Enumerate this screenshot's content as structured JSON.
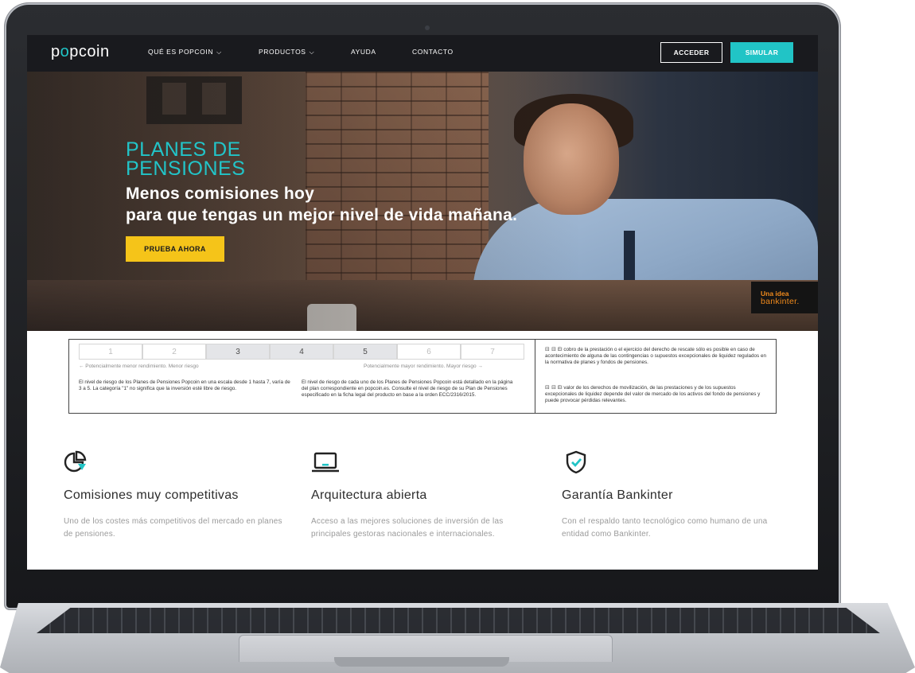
{
  "nav": {
    "logo_prefix": "p",
    "logo_o": "o",
    "logo_suffix": "pcoin",
    "items": [
      {
        "label": "QUÉ ES POPCOIN",
        "dropdown": true
      },
      {
        "label": "PRODUCTOS",
        "dropdown": true
      },
      {
        "label": "AYUDA",
        "dropdown": false
      },
      {
        "label": "CONTACTO",
        "dropdown": false
      }
    ],
    "chevron": "⌵",
    "acceder_label": "ACCEDER",
    "simular_label": "SIMULAR"
  },
  "hero": {
    "title_line1": "PLANES DE",
    "title_line2": "PENSIONES",
    "subtitle_line1": "Menos comisiones hoy",
    "subtitle_line2": "para que tengas un mejor nivel de vida mañana.",
    "cta_label": "PRUEBA AHORA",
    "badge_line1": "Una idea",
    "badge_line2": "bankinter."
  },
  "risk": {
    "scale": [
      "1",
      "2",
      "3",
      "4",
      "5",
      "6",
      "7"
    ],
    "active_range": [
      3,
      5
    ],
    "note_left": "← Potencialmente menor rendimiento. Menor riesgo",
    "note_right": "Potencialmente mayor rendimiento. Mayor riesgo →",
    "text_left": "El nivel de riesgo de los Planes de Pensiones Popcoin en una escala desde 1 hasta 7, varía de 3 a 5. La categoría \"1\" no significa que la inversión esté libre de riesgo.",
    "text_center": "El nivel de riesgo de cada uno de los Planes de Pensiones Popcoin está detallado en la página del plan correspondiente en popcoin.es. Consulte el nivel de riesgo de su Plan de Pensiones especificado en la ficha legal del producto en base a la orden ECC/2316/2015.",
    "note1": "El cobro de la prestación o el ejercicio del derecho de rescate sólo es posible en caso de acontecimiento de alguna de las contingencias o supuestos excepcionales de liquidez regulados en la normativa de planes y fondos de pensiones.",
    "note2": "El valor de los derechos de movilización, de las prestaciones y de los supuestos excepcionales de liquidez depende del valor de mercado de los activos del fondo de pensiones y puede provocar pérdidas relevantes."
  },
  "features": [
    {
      "icon": "pie-chart-icon",
      "title": "Comisiones muy competitivas",
      "desc": "Uno de los costes más competitivos del mercado en planes de pensiones."
    },
    {
      "icon": "laptop-icon",
      "title": "Arquitectura abierta",
      "desc": "Acceso a las mejores soluciones de inversión de las principales gestoras nacionales e internacionales."
    },
    {
      "icon": "shield-check-icon",
      "title": "Garantía Bankinter",
      "desc": "Con el respaldo tanto tecnológico como humano de una entidad como Bankinter."
    }
  ],
  "colors": {
    "accent_teal": "#21c4c6",
    "cta_yellow": "#f5c419",
    "nav_bg": "#191a1e",
    "badge_orange": "#f08a1c"
  }
}
